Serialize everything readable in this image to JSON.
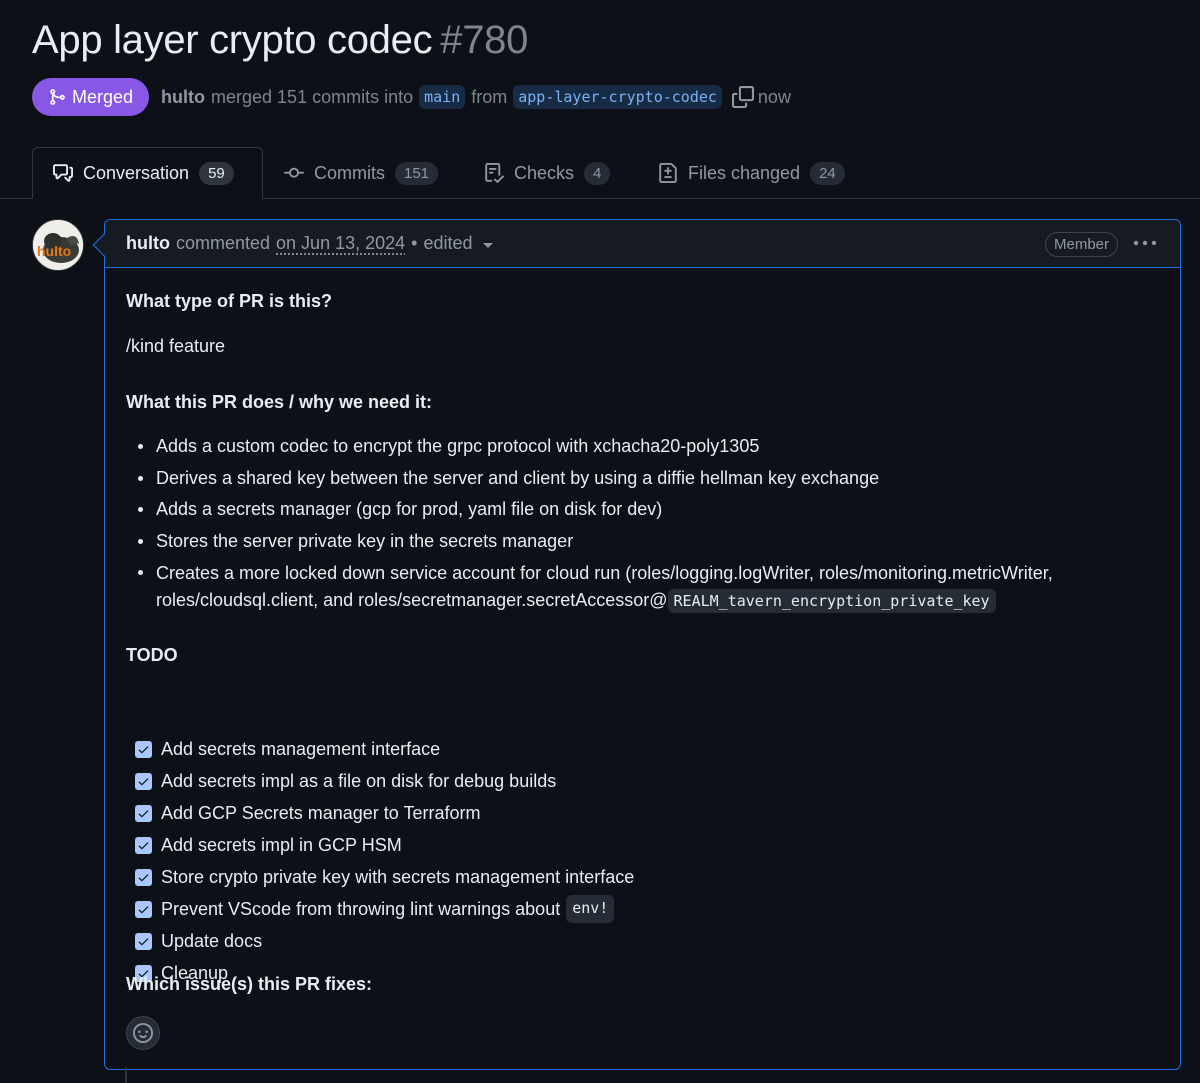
{
  "pr": {
    "title": "App layer crypto codec",
    "number": "#780",
    "state": "Merged",
    "author": "hulto",
    "action_text": "merged 151 commits into",
    "base_branch": "main",
    "from_text": "from",
    "head_branch": "app-layer-crypto-codec",
    "time": "now"
  },
  "tabs": [
    {
      "label": "Conversation",
      "count": "59",
      "icon": "comment-discussion-icon"
    },
    {
      "label": "Commits",
      "count": "151",
      "icon": "git-commit-icon"
    },
    {
      "label": "Checks",
      "count": "4",
      "icon": "checklist-icon"
    },
    {
      "label": "Files changed",
      "count": "24",
      "icon": "file-diff-icon"
    }
  ],
  "comment": {
    "author": "hulto",
    "verb": "commented",
    "date": "on Jun 13, 2024",
    "separator": "•",
    "edited": "edited",
    "role": "Member",
    "avatar_text": "hulto",
    "h1": "What type of PR is this?",
    "kind": "/kind feature",
    "h2": "What this PR does / why we need it:",
    "bullets": [
      "Adds a custom codec to encrypt the grpc protocol with xchacha20-poly1305",
      "Derives a shared key between the server and client by using a diffie hellman key exchange",
      "Adds a secrets manager (gcp for prod, yaml file on disk for dev)",
      "Stores the server private key in the secrets manager"
    ],
    "bullet5_line1": "Creates a more locked down service account for cloud run (roles/logging.logWriter, roles/monitoring.metricWriter,",
    "bullet5_line2": "roles/cloudsql.client, and roles/secretmanager.secretAccessor@",
    "bullet5_code": "REALM_tavern_encryption_private_key",
    "todo_heading": "TODO",
    "todos": [
      "Add secrets management interface",
      "Add secrets impl as a file on disk for debug builds",
      "Add GCP Secrets manager to Terraform",
      "Add secrets impl in GCP HSM",
      "Store crypto private key with secrets management interface",
      "Prevent VScode from throwing lint warnings about",
      "Update docs",
      "Cleanup"
    ],
    "todo6_code": "env!",
    "h3": "Which issue(s) this PR fixes:"
  },
  "colors": {
    "merged": "#8957e5",
    "accent_border": "#1f6feb",
    "checkbox": "#a8c7fa"
  }
}
